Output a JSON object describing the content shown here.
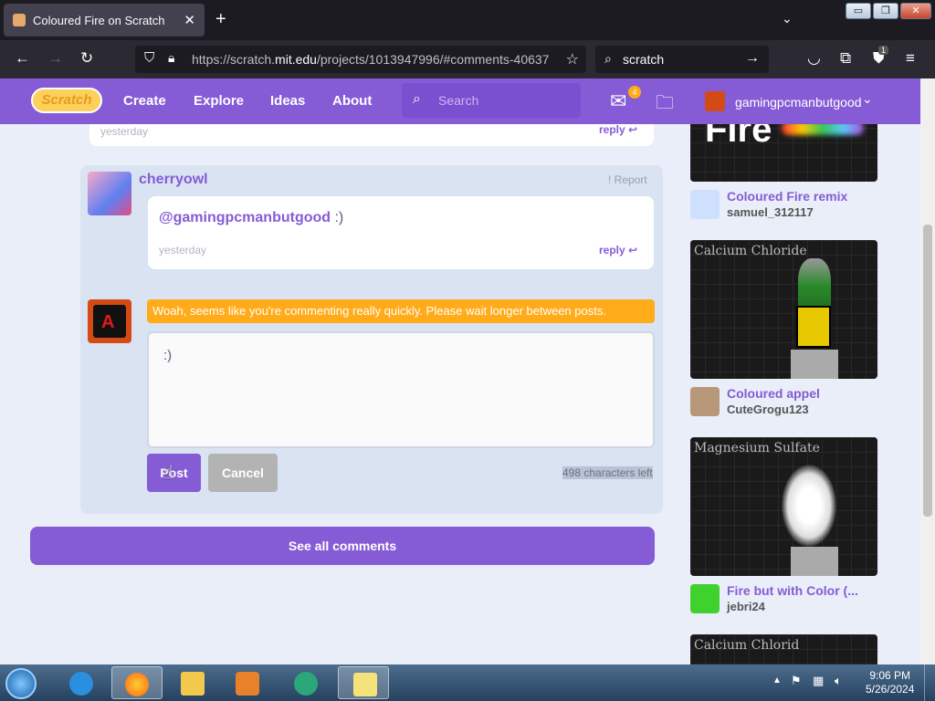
{
  "browser": {
    "tab_title": "Coloured Fire on Scratch",
    "url_prefix": "https://scratch.",
    "url_domain": "mit.edu",
    "url_path": "/projects/1013947996/#comments-40637",
    "search_text": "scratch",
    "notification_badge": "1"
  },
  "scratch_header": {
    "logo": "Scratch",
    "nav": [
      "Create",
      "Explore",
      "Ideas",
      "About"
    ],
    "search_placeholder": "Search",
    "messages_count": "4",
    "username": "gamingpcmanbutgood"
  },
  "comments": {
    "prev_comment": {
      "time": "yesterday",
      "reply": "reply"
    },
    "reply": {
      "author": "cherryowl",
      "report": "Report",
      "mention": "@gamingpcmanbutgood",
      "text": " :)",
      "time": "yesterday",
      "reply": "reply"
    },
    "compose": {
      "warning": "Woah, seems like you're commenting really quickly. Please wait longer between posts.",
      "text": ":)",
      "post_label": "Post",
      "cancel_label": "Cancel",
      "chars_left": "498 characters left"
    },
    "see_all": "See all comments"
  },
  "sidebar": {
    "projects": [
      {
        "title": "Coloured Fire remix",
        "user": "samuel_312117",
        "thumb_text": "Fire"
      },
      {
        "title": "Coloured appel",
        "user": "CuteGrogu123",
        "thumb_text": "Calcium Chloride"
      },
      {
        "title": "Fire but with Color (...",
        "user": "jebri24",
        "thumb_text": "Magnesium Sulfate"
      },
      {
        "title": "",
        "user": "",
        "thumb_text": "Calcium Chlorid"
      }
    ]
  },
  "taskbar": {
    "time": "9:06 PM",
    "date": "5/26/2024"
  },
  "colors": {
    "scratch_purple": "#855cd6",
    "warning_orange": "#ffab1a",
    "thread_bg": "#d9e3f2"
  }
}
